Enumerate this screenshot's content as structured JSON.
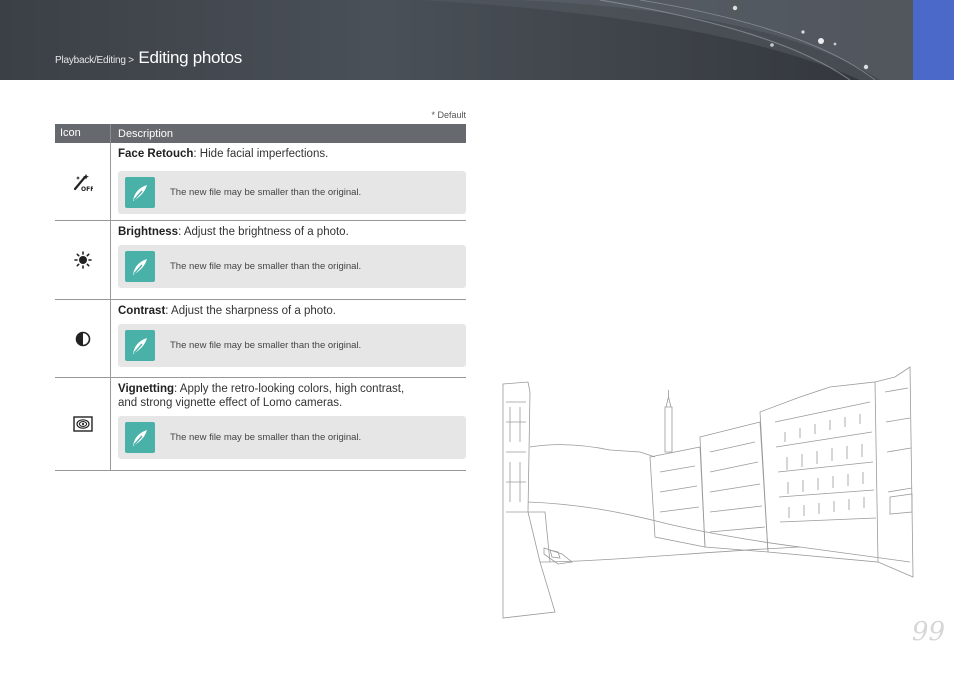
{
  "header": {
    "breadcrumb_prefix": "Playback/Editing >",
    "title": "Editing photos"
  },
  "default_note": "* Default",
  "table": {
    "col_icon": "Icon",
    "col_description": "Description",
    "rows": [
      {
        "icon": "face-retouch-off-icon",
        "term": "Face Retouch",
        "text": ": Hide facial imperfections.",
        "note": "The new file may be smaller than the original."
      },
      {
        "icon": "brightness-icon",
        "term": "Brightness",
        "text": ": Adjust the brightness of a photo.",
        "note": "The new file may be smaller than the original."
      },
      {
        "icon": "contrast-icon",
        "term": "Contrast",
        "text": ": Adjust the sharpness of a photo.",
        "note": "The new file may be smaller than the original."
      },
      {
        "icon": "vignetting-icon",
        "term": "Vignetting",
        "text": ": Apply the retro-looking colors, high contrast, and strong vignette effect of Lomo cameras.",
        "note": "The new file may be smaller than the original."
      }
    ]
  },
  "note_icon": "pen-note-icon",
  "page_number": "99",
  "colors": {
    "header_bg": "#3b4046",
    "header_accent": "#4a69c8",
    "table_head_bg": "#666a6e",
    "note_bg": "#e6e6e6",
    "note_icon_bg": "#4ab1a8"
  }
}
